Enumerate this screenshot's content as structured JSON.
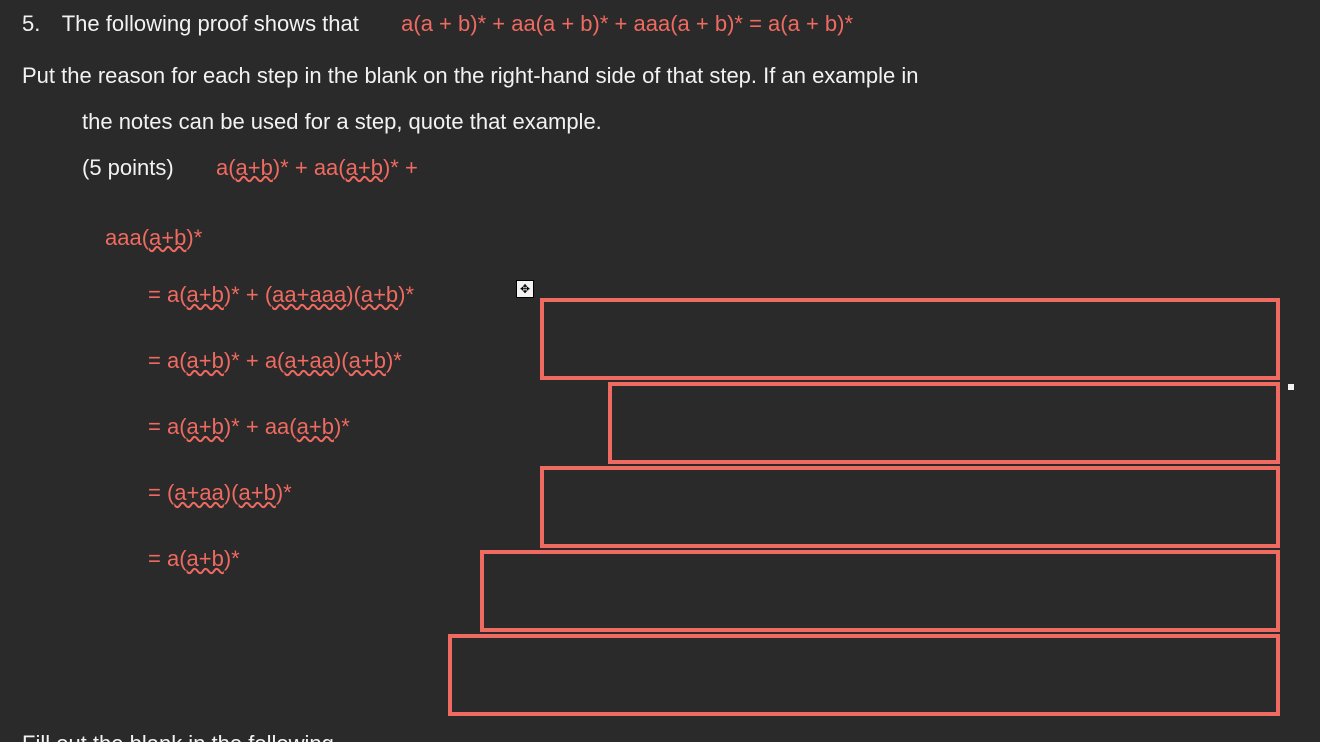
{
  "qnum": "5.",
  "intro_plain": "The following proof shows that",
  "intro_eq": "a(a + b)* + aa(a + b)* + aaa(a + b)* = a(a + b)*",
  "para_line1": "Put the reason for each step in the blank on the right-hand side of that step. If an example in",
  "para_line2": "the notes can be used for a step, quote that example.",
  "points_label": "(5 points)",
  "head_expr_line1": {
    "p1": "a(",
    "w1": "a+b",
    "p2": ")* + aa(",
    "w2": "a+b",
    "p3": ")* +"
  },
  "head_expr_line2": {
    "p1": "aaa(",
    "w1": "a+b",
    "p2": ")*"
  },
  "steps": [
    {
      "pre": "= a(",
      "w1": "a+b",
      "mid1": ")* + (",
      "w2": "aa+aaa",
      "mid2": ")(",
      "w3": "a+b",
      "post": ")*"
    },
    {
      "pre": "= a(",
      "w1": "a+b",
      "mid1": ")* + a(",
      "w2": "a+aa",
      "mid2": ")(",
      "w3": "a+b",
      "post": ")*"
    },
    {
      "pre": "= a(",
      "w1": "a+b",
      "mid1": ")* + aa(",
      "w2": "a+b",
      "mid2": "",
      "w3": "",
      "post": ")*"
    },
    {
      "pre": "= (",
      "w1": "a+aa",
      "mid1": ")(",
      "w2": "a+b",
      "mid2": "",
      "w3": "",
      "post": ")*"
    },
    {
      "pre": "= a(",
      "w1": "a+b",
      "mid1": "",
      "w2": "",
      "mid2": "",
      "w3": "",
      "post": ")*"
    }
  ],
  "move_glyph": "✥",
  "bottom_fragment": "Fill out the blank in the following"
}
